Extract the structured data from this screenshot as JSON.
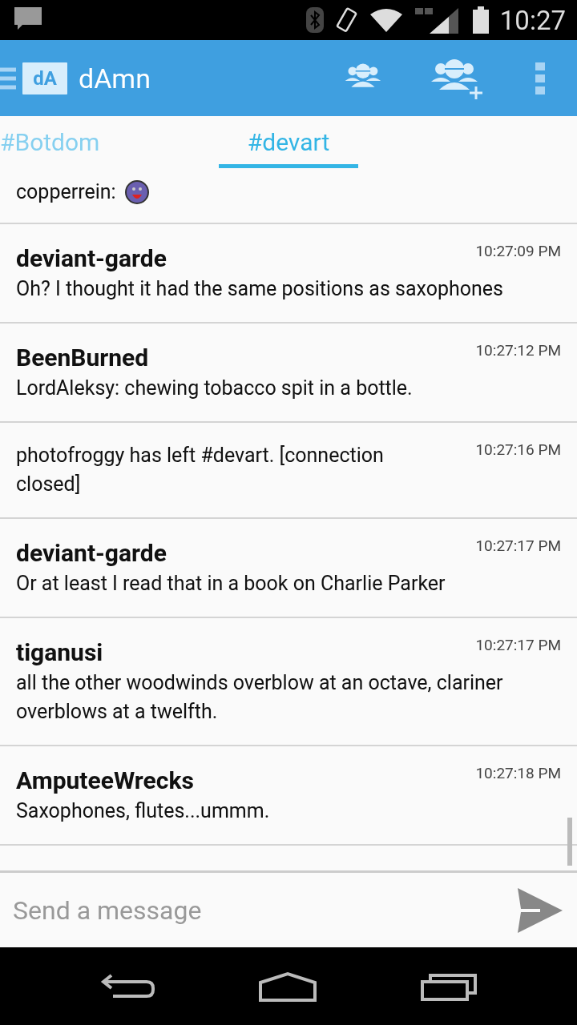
{
  "status_bar": {
    "time": "10:27"
  },
  "app_bar": {
    "title": "dAmn",
    "logo": "dA"
  },
  "tabs": [
    {
      "label": "#Botdom",
      "selected": false
    },
    {
      "label": "#devart",
      "selected": true
    }
  ],
  "messages": [
    {
      "kind": "emote",
      "text": "copperrein:"
    },
    {
      "kind": "message",
      "author": "deviant-garde",
      "time": "10:27:09 PM",
      "text": "Oh? I thought it had the same positions as saxophones"
    },
    {
      "kind": "message",
      "author": "BeenBurned",
      "time": "10:27:12 PM",
      "text": "LordAleksy: chewing tobacco spit in a bottle."
    },
    {
      "kind": "event",
      "time": "10:27:16 PM",
      "text": "photofroggy has left #devart. [connection closed]"
    },
    {
      "kind": "message",
      "author": "deviant-garde",
      "time": "10:27:17 PM",
      "text": "Or at least I read that in a book on Charlie Parker"
    },
    {
      "kind": "message",
      "author": "tiganusi",
      "time": "10:27:17 PM",
      "text": "all the other woodwinds overblow at an octave, clariner overblows at a twelfth."
    },
    {
      "kind": "message",
      "author": "AmputeeWrecks",
      "time": "10:27:18 PM",
      "text": "Saxophones, flutes...ummm."
    }
  ],
  "composer": {
    "placeholder": "Send a message"
  }
}
